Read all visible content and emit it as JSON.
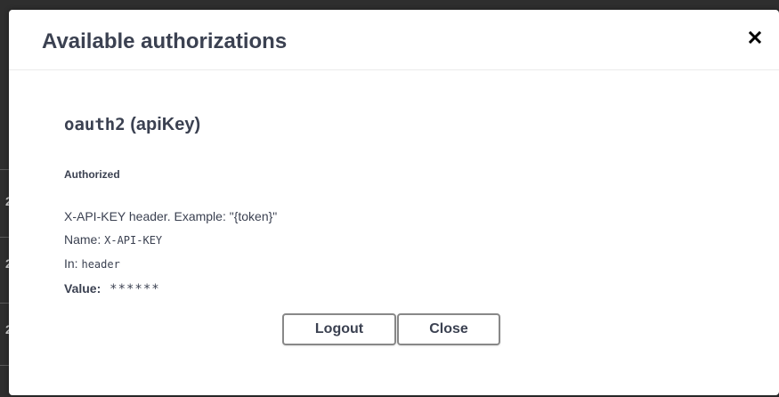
{
  "background": {
    "digits": [
      "2",
      "2",
      "2"
    ]
  },
  "modal": {
    "title": "Available authorizations",
    "close_icon": "close-icon"
  },
  "scheme": {
    "name": "oauth2",
    "type": "(apiKey)",
    "status": "Authorized",
    "description": "X-API-KEY header. Example: \"{token}\"",
    "name_label": "Name:",
    "name_value": "X-API-KEY",
    "in_label": "In:",
    "in_value": "header",
    "value_label": "Value:",
    "value_mask": "******"
  },
  "buttons": {
    "logout_label": "Logout",
    "close_label": "Close"
  },
  "colors": {
    "text": "#3b4151",
    "backdrop": "#2e2e2e",
    "button_border": "#888888"
  }
}
